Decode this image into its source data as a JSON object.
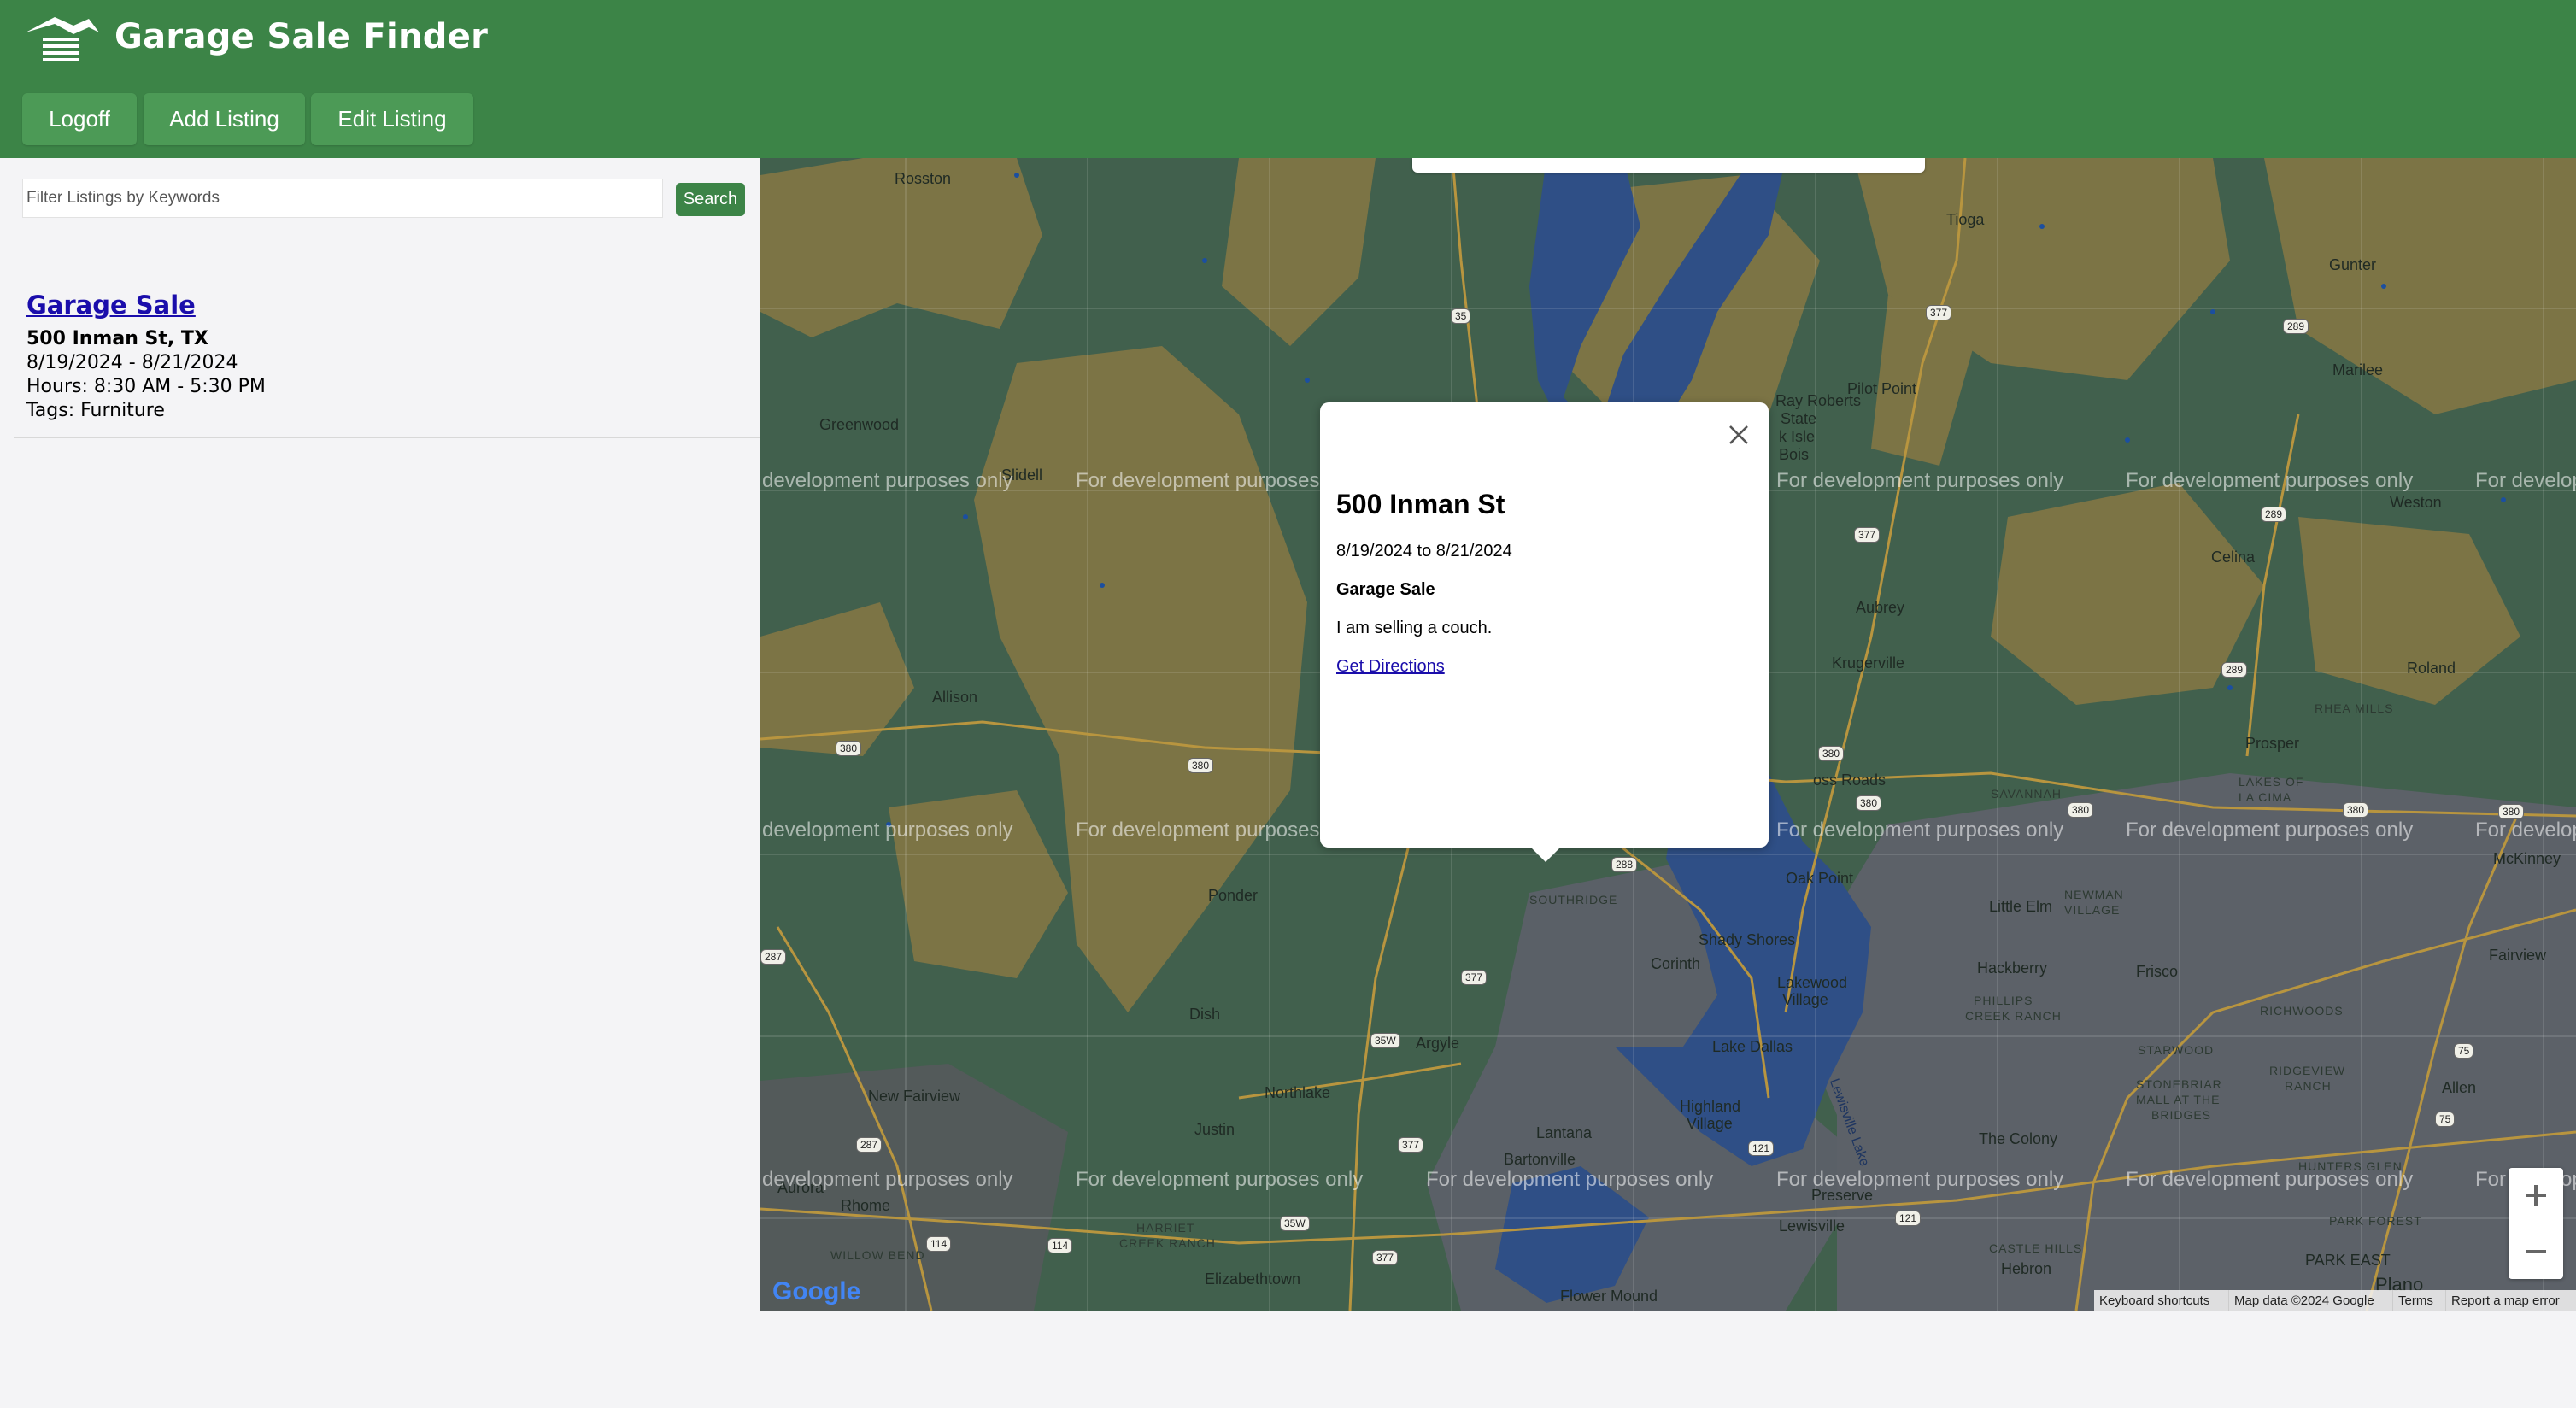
{
  "app": {
    "title": "Garage Sale Finder",
    "brand_color": "#3c8447",
    "logo_icon": "house-list-icon"
  },
  "nav": {
    "logoff": "Logoff",
    "add_listing": "Add Listing",
    "edit_listing": "Edit Listing"
  },
  "sidebar": {
    "search_placeholder": "Filter Listings by Keywords",
    "search_value": "",
    "search_button": "Search",
    "listings": [
      {
        "title": "Garage Sale",
        "address": "500 Inman St, TX",
        "dates": "8/19/2024 - 8/21/2024",
        "hours": "Hours: 8:30 AM - 5:30 PM",
        "tags": "Tags: Furniture"
      }
    ]
  },
  "map": {
    "watermark": "For development purposes only",
    "watermark_left_cut": "development purposes only",
    "watermark_right_cut": "For develop",
    "watermark_mid_cut": "For development purposes",
    "places": {
      "rosston": "Rosston",
      "tioga": "Tioga",
      "gunter": "Gunter",
      "marilee": "Marilee",
      "greenwood": "Greenwood",
      "slidell": "Slidell",
      "ray_roberts_1": "Ray Roberts",
      "ray_roberts_2": "State",
      "ray_roberts_3": "k Isle",
      "ray_roberts_4": "Bois",
      "pilot_point": "Pilot Point",
      "weston": "Weston",
      "celina": "Celina",
      "aubrey": "Aubrey",
      "krugerville": "Krugerville",
      "allison": "Allison",
      "roland": "Roland",
      "rhea_mills": "RHEA MILLS",
      "prosper": "Prosper",
      "lakes_1": "LAKES OF",
      "lakes_2": "LA CIMA",
      "cross_roads": "oss Roads",
      "savannah": "SAVANNAH",
      "mckinney": "McKinney",
      "ponder": "Ponder",
      "oak_point": "Oak Point",
      "southridge": "SOUTHRIDGE",
      "little_elm": "Little Elm",
      "newman_1": "NEWMAN",
      "newman_2": "VILLAGE",
      "shady_shores": "Shady Shores",
      "fairview": "Fairview",
      "corinth": "Corinth",
      "hackberry": "Hackberry",
      "frisco": "Frisco",
      "dish": "Dish",
      "lakewood_1": "Lakewood",
      "lakewood_2": "Village",
      "phillips_1": "PHILLIPS",
      "phillips_2": "CREEK RANCH",
      "richwoods": "RICHWOODS",
      "argyle": "Argyle",
      "lake_dallas": "Lake Dallas",
      "starwood": "STARWOOD",
      "new_fairview": "New Fairview",
      "northlake": "Northlake",
      "highland_1": "Highland",
      "highland_2": "Village",
      "stonebriar_1": "STONEBRIAR",
      "stonebriar_2": "MALL AT THE",
      "stonebriar_3": "BRIDGES",
      "ridgeview_1": "RIDGEVIEW",
      "ridgeview_2": "RANCH",
      "allen": "Allen",
      "justin": "Justin",
      "lantana": "Lantana",
      "the_colony": "The Colony",
      "aurora": "Aurora",
      "rhome": "Rhome",
      "bartonville": "Bartonville",
      "preserve": "Preserve",
      "hunters_1": "HUNTERS GLEN",
      "park_forest": "PARK FOREST",
      "harriet_1": "HARRIET",
      "harriet_2": "CREEK RANCH",
      "lewisville": "Lewisville",
      "castle_1": "CASTLE HILLS",
      "hebron": "Hebron",
      "park_east": "PARK EAST",
      "willow_bend": "WILLOW BEND",
      "elizabethtown": "Elizabethtown",
      "flower_mound": "Flower Mound",
      "plano": "Plano",
      "lewisville_lake": "Lewisville Lake"
    },
    "shields": [
      "35",
      "377",
      "289",
      "377",
      "289",
      "289",
      "380",
      "380",
      "380",
      "380",
      "380",
      "380",
      "380",
      "288",
      "377",
      "35W",
      "377",
      "287",
      "287",
      "114",
      "114",
      "35W",
      "377",
      "121",
      "75",
      "75",
      "121"
    ],
    "popup": {
      "title": "500 Inman St",
      "dates": "8/19/2024 to 8/21/2024",
      "type": "Garage Sale",
      "description": "I am selling a couch.",
      "link": "Get Directions",
      "close_icon": "close-icon"
    },
    "zoom_in": "+",
    "zoom_out": "−",
    "google": "Google",
    "attribution": {
      "shortcuts": "Keyboard shortcuts",
      "map_data": "Map data ©2024 Google",
      "terms": "Terms",
      "report": "Report a map error"
    }
  }
}
